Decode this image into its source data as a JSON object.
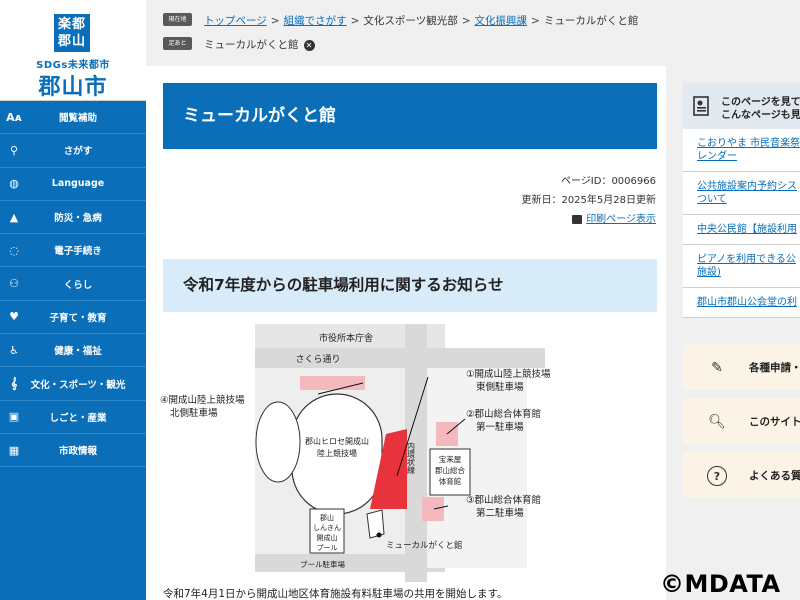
{
  "logo": {
    "mark": "楽都\n郡山",
    "sdgs": "SDGs未来都市",
    "city": "郡山市"
  },
  "sidebar": {
    "items": [
      {
        "label": "閲覧補助",
        "icon": "text-size-icon"
      },
      {
        "label": "さがす",
        "icon": "search-icon"
      },
      {
        "label": "Language",
        "icon": "globe-icon"
      },
      {
        "label": "防災・急病",
        "icon": "warning-icon"
      },
      {
        "label": "電子手続き",
        "icon": "chat-icon"
      },
      {
        "label": "くらし",
        "icon": "people-icon"
      },
      {
        "label": "子育て・教育",
        "icon": "heart-icon"
      },
      {
        "label": "健康・福祉",
        "icon": "wheelchair-icon"
      },
      {
        "label": "文化・スポーツ・観光",
        "icon": "music-note-icon"
      },
      {
        "label": "しごと・産業",
        "icon": "briefcase-icon"
      },
      {
        "label": "市政情報",
        "icon": "building-icon"
      }
    ]
  },
  "breadcrumb": {
    "current_badge": "現在地",
    "trail": [
      {
        "label": "トップページ",
        "link": true
      },
      {
        "label": "組織でさがす",
        "link": true
      },
      {
        "label": "文化スポーツ観光部",
        "link": false
      },
      {
        "label": "文化振興課",
        "link": true
      },
      {
        "label": "ミューカルがくと館",
        "link": false
      }
    ],
    "footprint_badge": "足あと",
    "footprint_item": "ミューカルがくと館"
  },
  "main": {
    "title": "ミューカルがくと館",
    "page_id": "ページID：0006966",
    "updated": "更新日：2025年5月28日更新",
    "print_label": "印刷ページ表示",
    "section_title": "令和7年度からの駐車場利用に関するお知らせ",
    "body_text": "令和7年4月1日から開成山地区体育施設有料駐車場の共用を開始します。"
  },
  "map": {
    "city_hall": "市役所本庁舎",
    "sakura": "さくら通り",
    "lot1": "①開成山陸上競技場",
    "lot1b": "東側駐車場",
    "lot2": "②郡山総合体育館",
    "lot2b": "第一駐車場",
    "lot3": "③郡山総合体育館",
    "lot3b": "第二駐車場",
    "lot4": "④開成山陸上競技場",
    "lot4b": "北側駐車場",
    "stadium1": "郡山ヒロセ開成山",
    "stadium2": "陸上競技場",
    "ring_road": "内環状線",
    "gym1": "宝来屋",
    "gym2": "郡山総合",
    "gym3": "体育館",
    "pool1": "郡山",
    "pool2": "しんきん",
    "pool3": "開成山",
    "pool4": "プール",
    "gakuto": "ミューカルがくと館",
    "pool_lot": "プール駐車場"
  },
  "right": {
    "related_title1": "このページを見て",
    "related_title2": "こんなページも見",
    "related": [
      {
        "line1": "こおりやま 市民音楽祭",
        "line2": "レンダー"
      },
      {
        "line1": "公共施設案内予約シス",
        "line2": "ついて"
      },
      {
        "line1": "中央公民館【施設利用",
        "line2": ""
      },
      {
        "line1": "ピアノを利用できる公",
        "line2": "施設)"
      },
      {
        "line1": "郡山市郡山公会堂の利",
        "line2": ""
      }
    ],
    "cards": [
      {
        "label": "各種申請・",
        "icon": "pencil-icon"
      },
      {
        "label": "このサイト",
        "icon": "document-search-icon"
      },
      {
        "label": "よくある質",
        "icon": "question-icon"
      }
    ]
  },
  "watermark": "©MDATA",
  "colors": {
    "brand_blue": "#0a6fb8",
    "section_band": "#d8ebf9",
    "parking_red": "#e8323c",
    "parking_pink": "#f4b9bd"
  }
}
